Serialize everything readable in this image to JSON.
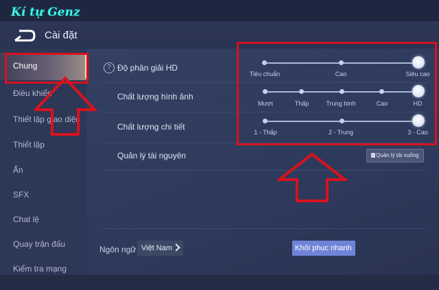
{
  "watermark": "Kí tự Genz",
  "header": {
    "title": "Cài đặt",
    "back_icon": "back-arrow-icon"
  },
  "sidebar": {
    "items": [
      {
        "label": "Chung",
        "active": true
      },
      {
        "label": "Điều khiển"
      },
      {
        "label": "Thiết lập giao diện"
      },
      {
        "label": "Thiết lập"
      },
      {
        "label": "Ấn"
      },
      {
        "label": "SFX"
      },
      {
        "label": "Chat lệ"
      },
      {
        "label": "Quay trận đấu"
      },
      {
        "label": "Kiểm tra mạng"
      }
    ]
  },
  "settings": {
    "resolution": {
      "label": "Độ phân giải HD",
      "options": [
        "Tiêu chuẩn",
        "Cao",
        "Siêu cao"
      ],
      "selected": "Siêu cao"
    },
    "image_quality": {
      "label": "Chất lượng hình ảnh",
      "options": [
        "Mượt",
        "Thấp",
        "Trung bình",
        "Cao",
        "HD"
      ],
      "selected": "HD"
    },
    "detail_quality": {
      "label": "Chất lượng chi tiết",
      "options": [
        "1 - Thấp",
        "2 - Trung",
        "3 - Cao"
      ],
      "selected": "3 - Cao"
    },
    "resources": {
      "label": "Quản lý tài nguyên",
      "button_label": "Quản lý tải xuống"
    }
  },
  "footer": {
    "language_label": "Ngôn ngữ",
    "language_value": "Việt Nam",
    "restore_label": "Khôi phục nhanh"
  },
  "colors": {
    "highlight": "#d8121d",
    "accent": "#6f84d8"
  }
}
